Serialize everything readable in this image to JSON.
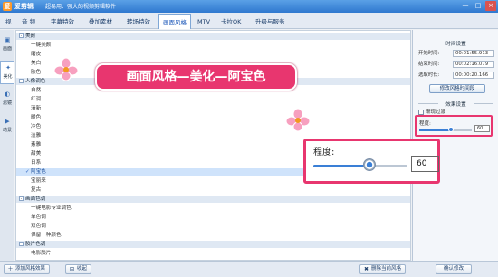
{
  "app": {
    "logo_letter": "爱",
    "title": "爱剪辑",
    "slogan": "超易用、强大的视频剪辑软件"
  },
  "window": {
    "minimize": "—",
    "maximize": "□",
    "close": "×"
  },
  "menu_tabs": [
    "视",
    "音  频",
    "字幕特效",
    "叠加素材",
    "转场特效",
    "画面风格",
    "MTV",
    "卡拉OK",
    "升级与服务"
  ],
  "active_tab_index": 5,
  "side_tabs": [
    {
      "label": "画面",
      "icon": "image-icon"
    },
    {
      "label": "美化",
      "icon": "magic-wand-icon"
    },
    {
      "label": "滤镜",
      "icon": "filter-icon"
    },
    {
      "label": "动景",
      "icon": "motion-icon"
    }
  ],
  "active_side_tab_index": 1,
  "style_list": [
    {
      "type": "header",
      "label": "美颜",
      "toggle": "-"
    },
    {
      "type": "item",
      "label": "一键美颜"
    },
    {
      "type": "item",
      "label": "磨皮"
    },
    {
      "type": "item",
      "label": "美白"
    },
    {
      "type": "item",
      "label": "肤色"
    },
    {
      "type": "header",
      "label": "人像调色",
      "toggle": "-"
    },
    {
      "type": "item",
      "label": "自然"
    },
    {
      "type": "item",
      "label": "红润"
    },
    {
      "type": "item",
      "label": "清新"
    },
    {
      "type": "item",
      "label": "暖色"
    },
    {
      "type": "item",
      "label": "冷色"
    },
    {
      "type": "item",
      "label": "淡雅"
    },
    {
      "type": "item",
      "label": "素雅"
    },
    {
      "type": "item",
      "label": "甜美"
    },
    {
      "type": "item",
      "label": "日系"
    },
    {
      "type": "item",
      "label": "阿宝色",
      "selected": true,
      "check": "✓"
    },
    {
      "type": "item",
      "label": "宝丽来"
    },
    {
      "type": "item",
      "label": "复古"
    },
    {
      "type": "header",
      "label": "画面色调",
      "toggle": "-"
    },
    {
      "type": "item",
      "label": "一键电影专业调色"
    },
    {
      "type": "item",
      "label": "单色调"
    },
    {
      "type": "item",
      "label": "双色调"
    },
    {
      "type": "item",
      "label": "保留一种颜色"
    },
    {
      "type": "header",
      "label": "胶片色调",
      "toggle": "-"
    },
    {
      "type": "item",
      "label": "电影胶片"
    }
  ],
  "banner": {
    "text": "画面风格—美化—阿宝色"
  },
  "time_settings": {
    "title": "时间设置",
    "start_label": "开始时间:",
    "start_value": "00:01:55.913",
    "end_label": "结束时间:",
    "end_value": "00:02:16.079",
    "duration_label": "选取时长:",
    "duration_value": "00:00:20.166",
    "modify_button": "修改风格时间段"
  },
  "effect_settings": {
    "title": "效果设置",
    "fade_checkbox_label": "渐现过渡",
    "fade_checked": false,
    "degree_label": "程度:",
    "degree_value": "60",
    "degree_fraction": 0.6
  },
  "zoom_callout": {
    "label": "程度:",
    "value": "60"
  },
  "bottom": {
    "add_button": "添加风格效果",
    "favorite_button": "收起",
    "delete_button": "删除当前风格",
    "confirm_button": "确认修改"
  },
  "colors": {
    "accent": "#e8366f",
    "titlebar": "#2f78cf",
    "slider": "#3a7fd6"
  }
}
